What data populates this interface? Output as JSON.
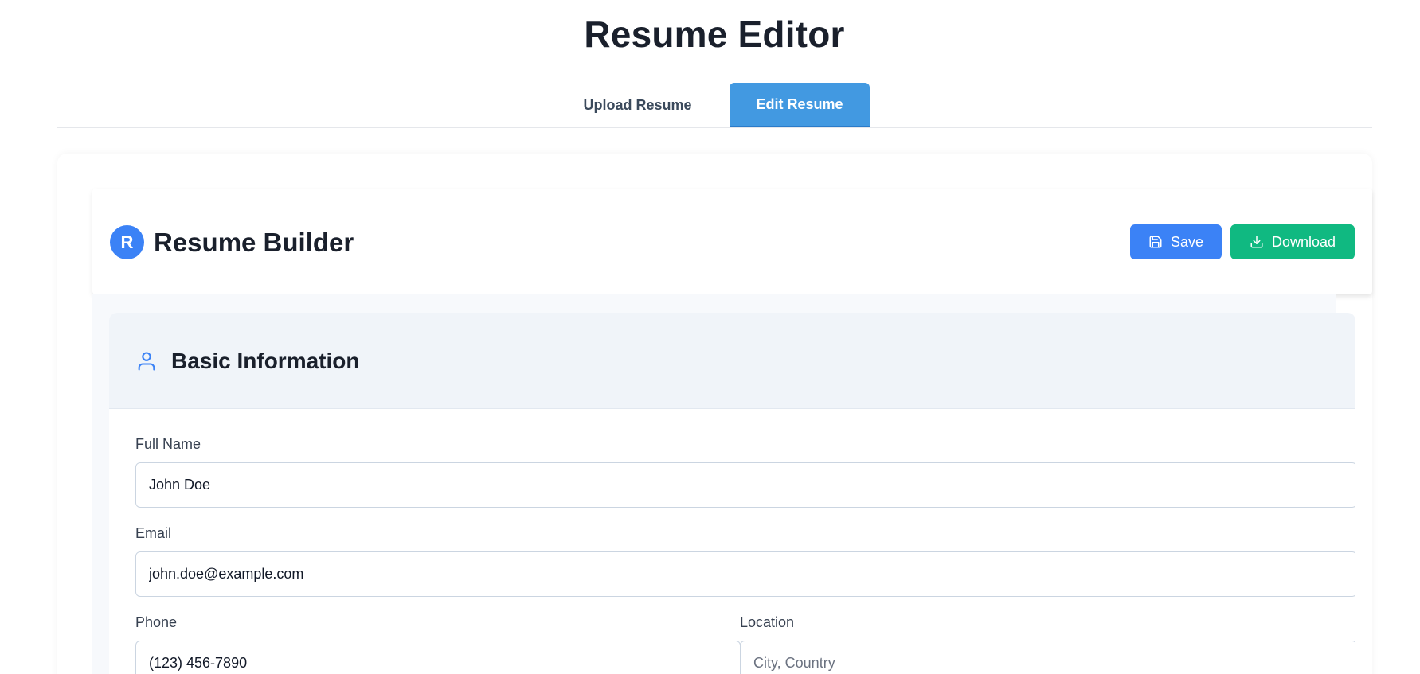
{
  "app": {
    "title": "Resume Editor"
  },
  "tabs": [
    {
      "label": "Upload Resume",
      "active": false
    },
    {
      "label": "Edit Resume",
      "active": true
    }
  ],
  "builder": {
    "logo_letter": "R",
    "title": "Resume Builder",
    "save_label": "Save",
    "download_label": "Download",
    "save_icon": "floppy-disk-icon",
    "download_icon": "download-icon"
  },
  "section": {
    "icon": "user-icon",
    "title": "Basic Information"
  },
  "fields": {
    "full_name": {
      "label": "Full Name",
      "value": "John Doe"
    },
    "email": {
      "label": "Email",
      "value": "john.doe@example.com"
    },
    "phone": {
      "label": "Phone",
      "value": "(123) 456-7890"
    },
    "location": {
      "label": "Location",
      "value": "",
      "placeholder": "City, Country"
    }
  },
  "colors": {
    "accent_blue": "#3b82f6",
    "tab_active": "#4299e1",
    "download_green": "#10b981",
    "section_header_bg": "#f0f4f9"
  }
}
